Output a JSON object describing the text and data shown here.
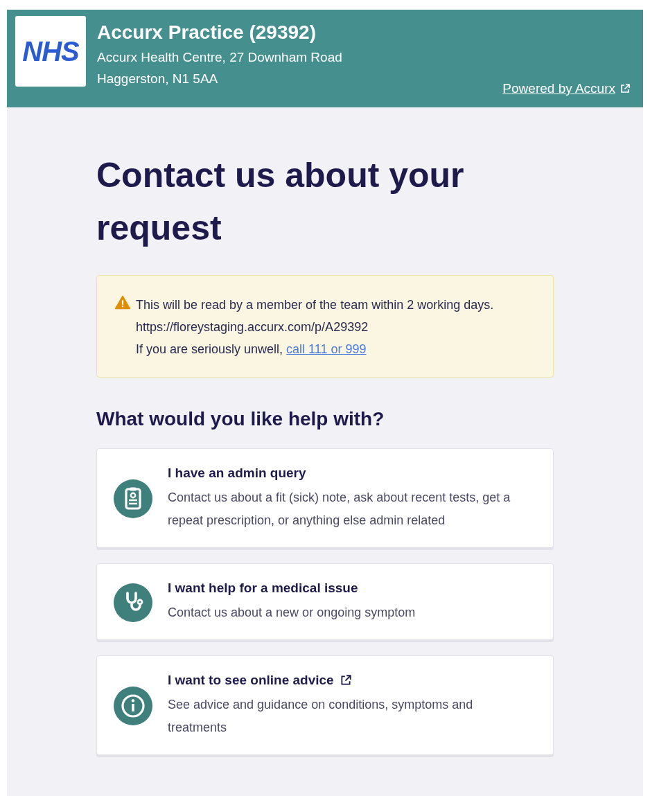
{
  "header": {
    "logo": "NHS",
    "practice_name": "Accurx Practice (29392)",
    "address_lines": [
      "Accurx Health Centre, 27 Downham Road",
      "Haggerston, N1 5AA"
    ],
    "powered_link": "Powered by Accurx"
  },
  "title": "Contact us about your request",
  "alert": {
    "message": "This will be read by a member of the team within 2 working days. https://floreystaging.accurx.com/p/A29392",
    "prefix": "If you are seriously unwell, ",
    "link": "call 111 or 999"
  },
  "question": "What would you like help with?",
  "options": [
    {
      "kind": "clipboard",
      "title": "I have an admin query",
      "description": "Contact us about a fit (sick) note, ask about recent tests, get a repeat prescription, or anything else admin related",
      "external": false
    },
    {
      "kind": "stethoscope",
      "title": "I want help for a medical issue",
      "description": "Contact us about a new or ongoing symptom",
      "external": false
    },
    {
      "kind": "info",
      "title": "I want to see online advice",
      "description": "See advice and guidance on conditions, symptoms and treatments",
      "external": true
    }
  ]
}
